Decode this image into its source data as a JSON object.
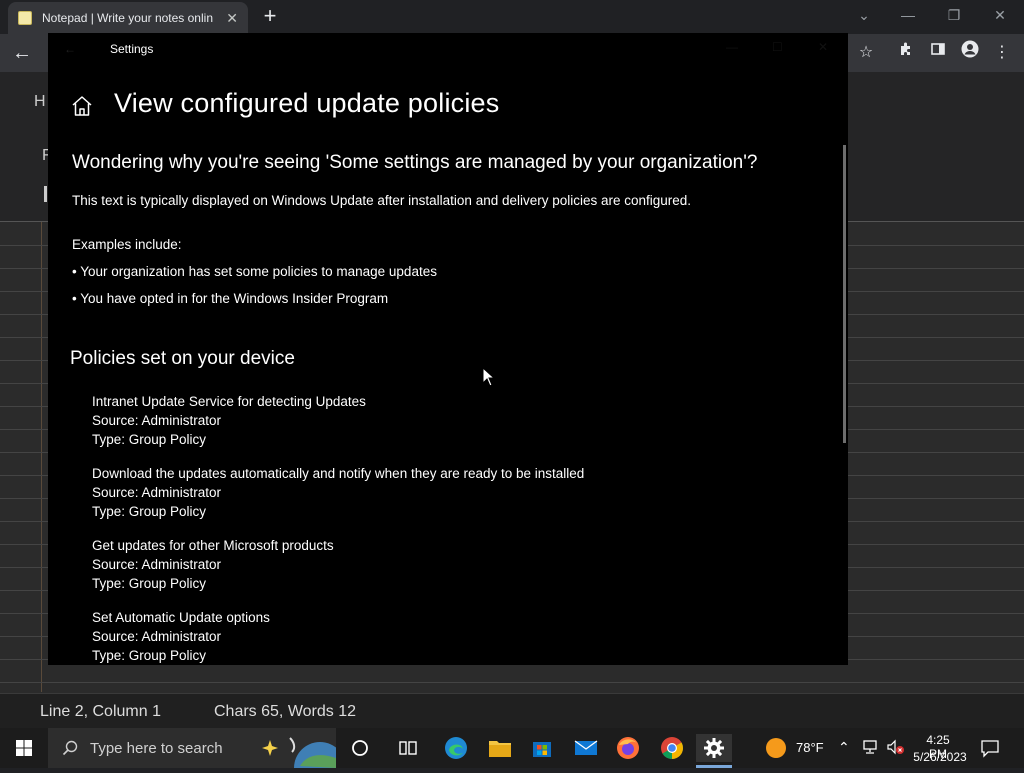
{
  "browser": {
    "tab_title": "Notepad | Write your notes onlin",
    "tab_close": "✕",
    "new_tab": "+"
  },
  "notepad": {
    "statusbar": {
      "position": "Line 2, Column 1",
      "counts": "Chars 65, Words 12"
    }
  },
  "settings": {
    "window_title": "Settings",
    "page_title": "View configured update policies",
    "managed_heading": "Wondering why you're seeing 'Some settings are managed by your organization'?",
    "managed_desc": "This text is typically displayed on Windows Update after installation and delivery policies are configured.",
    "examples_label": "Examples include:",
    "examples": [
      "• Your organization has set some policies to manage updates",
      "• You have opted in for the Windows Insider Program"
    ],
    "policies_heading": "Policies set on your device",
    "policies": [
      {
        "name": "Intranet Update Service for detecting Updates",
        "source": "Source: Administrator",
        "type": "Type: Group Policy"
      },
      {
        "name": "Download the updates automatically and notify when they are ready to be installed",
        "source": "Source: Administrator",
        "type": "Type: Group Policy"
      },
      {
        "name": "Get updates for other Microsoft products",
        "source": "Source: Administrator",
        "type": "Type: Group Policy"
      },
      {
        "name": "Set Automatic Update options",
        "source": "Source: Administrator",
        "type": "Type: Group Policy"
      }
    ]
  },
  "taskbar": {
    "search_placeholder": "Type here to search",
    "weather_temp": "78°F",
    "time": "4:25 PM",
    "date": "5/26/2023"
  },
  "colors": {
    "settings_bg": "#000000",
    "taskbar_bg": "#1c1c1c",
    "chrome_toolbar": "#35363a",
    "accent_active": "#7aa7d9"
  }
}
